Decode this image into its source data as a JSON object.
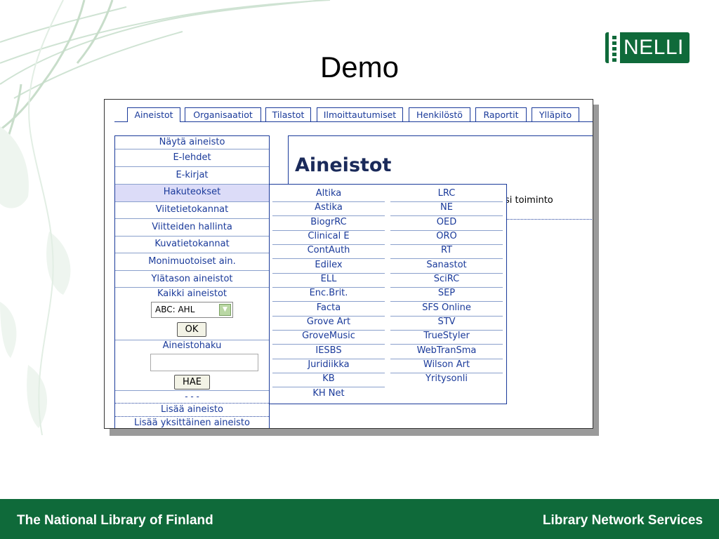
{
  "slide": {
    "title": "Demo"
  },
  "logo": {
    "text": "NELLI"
  },
  "tabs": [
    "Aineistot",
    "Organisaatiot",
    "Tilastot",
    "Ilmoittautumiset",
    "Henkilöstö",
    "Raportit",
    "Ylläpito"
  ],
  "active_tab": "Aineistot",
  "sidebar": {
    "header": "Näytä aineisto",
    "items": [
      "E-lehdet",
      "E-kirjat",
      "Hakuteokset",
      "Viitetietokannat",
      "Viitteiden hallinta",
      "Kuvatietokannat",
      "Monimuotoiset ain.",
      "Ylätason aineistot"
    ],
    "highlighted_item": "Hakuteokset",
    "all_label": "Kaikki aineistot",
    "select_value": "ABC: AHL",
    "ok_button": "OK",
    "search_label": "Aineistohaku",
    "search_value": "",
    "search_button": "HAE",
    "separator": "- - -",
    "add_resource": "Lisää aineisto",
    "add_single": "Lisää yksittäinen aineisto"
  },
  "content": {
    "heading": "Aineistot",
    "partial_text": "si toiminto"
  },
  "dropdown": {
    "col1": [
      "Altika",
      "Astika",
      "BiogrRC",
      "Clinical E",
      "ContAuth",
      "Edilex",
      "ELL",
      "Enc.Brit.",
      "Facta",
      "Grove Art",
      "GroveMusic",
      "IESBS",
      "Juridiikka",
      "KB",
      "KH Net"
    ],
    "col2": [
      "LRC",
      "NE",
      "OED",
      "ORO",
      "RT",
      "Sanastot",
      "SciRC",
      "SEP",
      "SFS Online",
      "STV",
      "TrueStyler",
      "WebTranSma",
      "Wilson Art",
      "Yritysonli"
    ]
  },
  "footer": {
    "left": "The National Library of Finland",
    "right": "Library Network Services"
  },
  "colors": {
    "footer_green": "#0f6a3a",
    "link_blue": "#1a3a9a",
    "highlight": "#dcdcf8"
  }
}
